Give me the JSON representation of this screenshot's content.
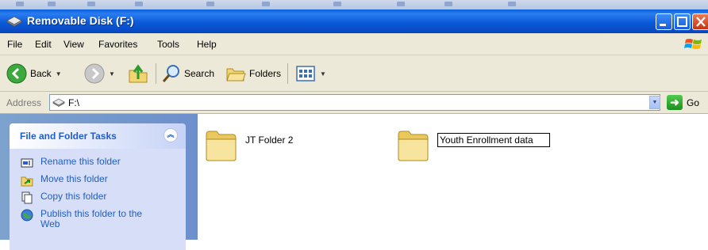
{
  "window": {
    "title": "Removable Disk (F:)"
  },
  "menu": [
    "File",
    "Edit",
    "View",
    "Favorites",
    "Tools",
    "Help"
  ],
  "toolbar": {
    "back_label": "Back",
    "search_label": "Search",
    "folders_label": "Folders"
  },
  "address": {
    "label": "Address",
    "value": "F:\\",
    "go_label": "Go"
  },
  "tasks_panel": {
    "title": "File and Folder Tasks",
    "items": [
      {
        "label": "Rename this folder",
        "icon": "rename-icon"
      },
      {
        "label": "Move this folder",
        "icon": "move-icon"
      },
      {
        "label": "Copy this folder",
        "icon": "copy-icon"
      },
      {
        "label": "Publish this folder to the Web",
        "icon": "publish-icon"
      }
    ]
  },
  "folders": [
    {
      "name": "JT Folder 2"
    },
    {
      "name": "Youth Enrollment data",
      "renaming": true
    }
  ],
  "colors": {
    "title_bar": "#0a5fdc",
    "task_link": "#215dc6",
    "left_pane": "#7da2ce"
  }
}
